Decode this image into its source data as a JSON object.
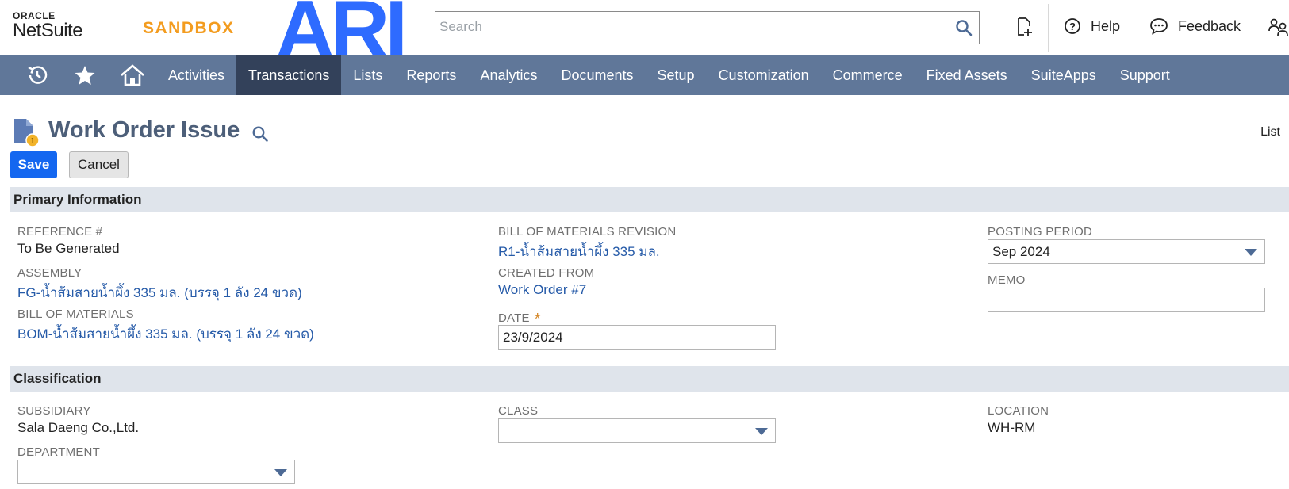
{
  "header": {
    "oracle_label": "ORACLE",
    "netsuite_label": "NetSuite",
    "sandbox_label": "SANDBOX",
    "brand_logo_text": "ARI",
    "search_placeholder": "Search",
    "help_label": "Help",
    "feedback_label": "Feedback"
  },
  "nav": {
    "items": [
      {
        "label": "Activities",
        "active": false
      },
      {
        "label": "Transactions",
        "active": true
      },
      {
        "label": "Lists",
        "active": false
      },
      {
        "label": "Reports",
        "active": false
      },
      {
        "label": "Analytics",
        "active": false
      },
      {
        "label": "Documents",
        "active": false
      },
      {
        "label": "Setup",
        "active": false
      },
      {
        "label": "Customization",
        "active": false
      },
      {
        "label": "Commerce",
        "active": false
      },
      {
        "label": "Fixed Assets",
        "active": false
      },
      {
        "label": "SuiteApps",
        "active": false
      },
      {
        "label": "Support",
        "active": false
      }
    ]
  },
  "page": {
    "title": "Work Order Issue",
    "list_link": "List",
    "save_label": "Save",
    "cancel_label": "Cancel"
  },
  "primary": {
    "section_title": "Primary Information",
    "reference_label": "REFERENCE #",
    "reference_value": "To Be Generated",
    "assembly_label": "ASSEMBLY",
    "assembly_value": "FG-น้ำส้มสายน้ำผึ้ง 335 มล. (บรรจุ 1 ลัง 24 ขวด)",
    "bom_label": "BILL OF MATERIALS",
    "bom_value": "BOM-น้ำส้มสายน้ำผึ้ง 335 มล. (บรรจุ 1 ลัง 24 ขวด)",
    "bom_revision_label": "BILL OF MATERIALS REVISION",
    "bom_revision_value": "R1-น้ำส้มสายน้ำผึ้ง 335 มล.",
    "created_from_label": "CREATED FROM",
    "created_from_value": "Work Order #7",
    "date_label": "DATE",
    "date_required_mark": "*",
    "date_value": "23/9/2024",
    "posting_period_label": "POSTING PERIOD",
    "posting_period_value": "Sep 2024",
    "memo_label": "MEMO",
    "memo_value": ""
  },
  "classification": {
    "section_title": "Classification",
    "subsidiary_label": "SUBSIDIARY",
    "subsidiary_value": "Sala Daeng Co.,Ltd.",
    "department_label": "DEPARTMENT",
    "department_value": "",
    "class_label": "CLASS",
    "class_value": "",
    "location_label": "LOCATION",
    "location_value": "WH-RM"
  },
  "colors": {
    "nav_bg": "#607799",
    "nav_active": "#33415a",
    "save_button": "#1467f0",
    "sandbox": "#f39c1f",
    "brand_logo": "#2e6bff",
    "link": "#255aa8",
    "section_bg": "#dfe4eb"
  },
  "icons": [
    "recent-records-icon",
    "star-icon",
    "home-icon",
    "search-icon",
    "create-new-icon",
    "help-circle-icon",
    "feedback-bubble-icon",
    "switch-role-icon",
    "document-coin-icon"
  ]
}
